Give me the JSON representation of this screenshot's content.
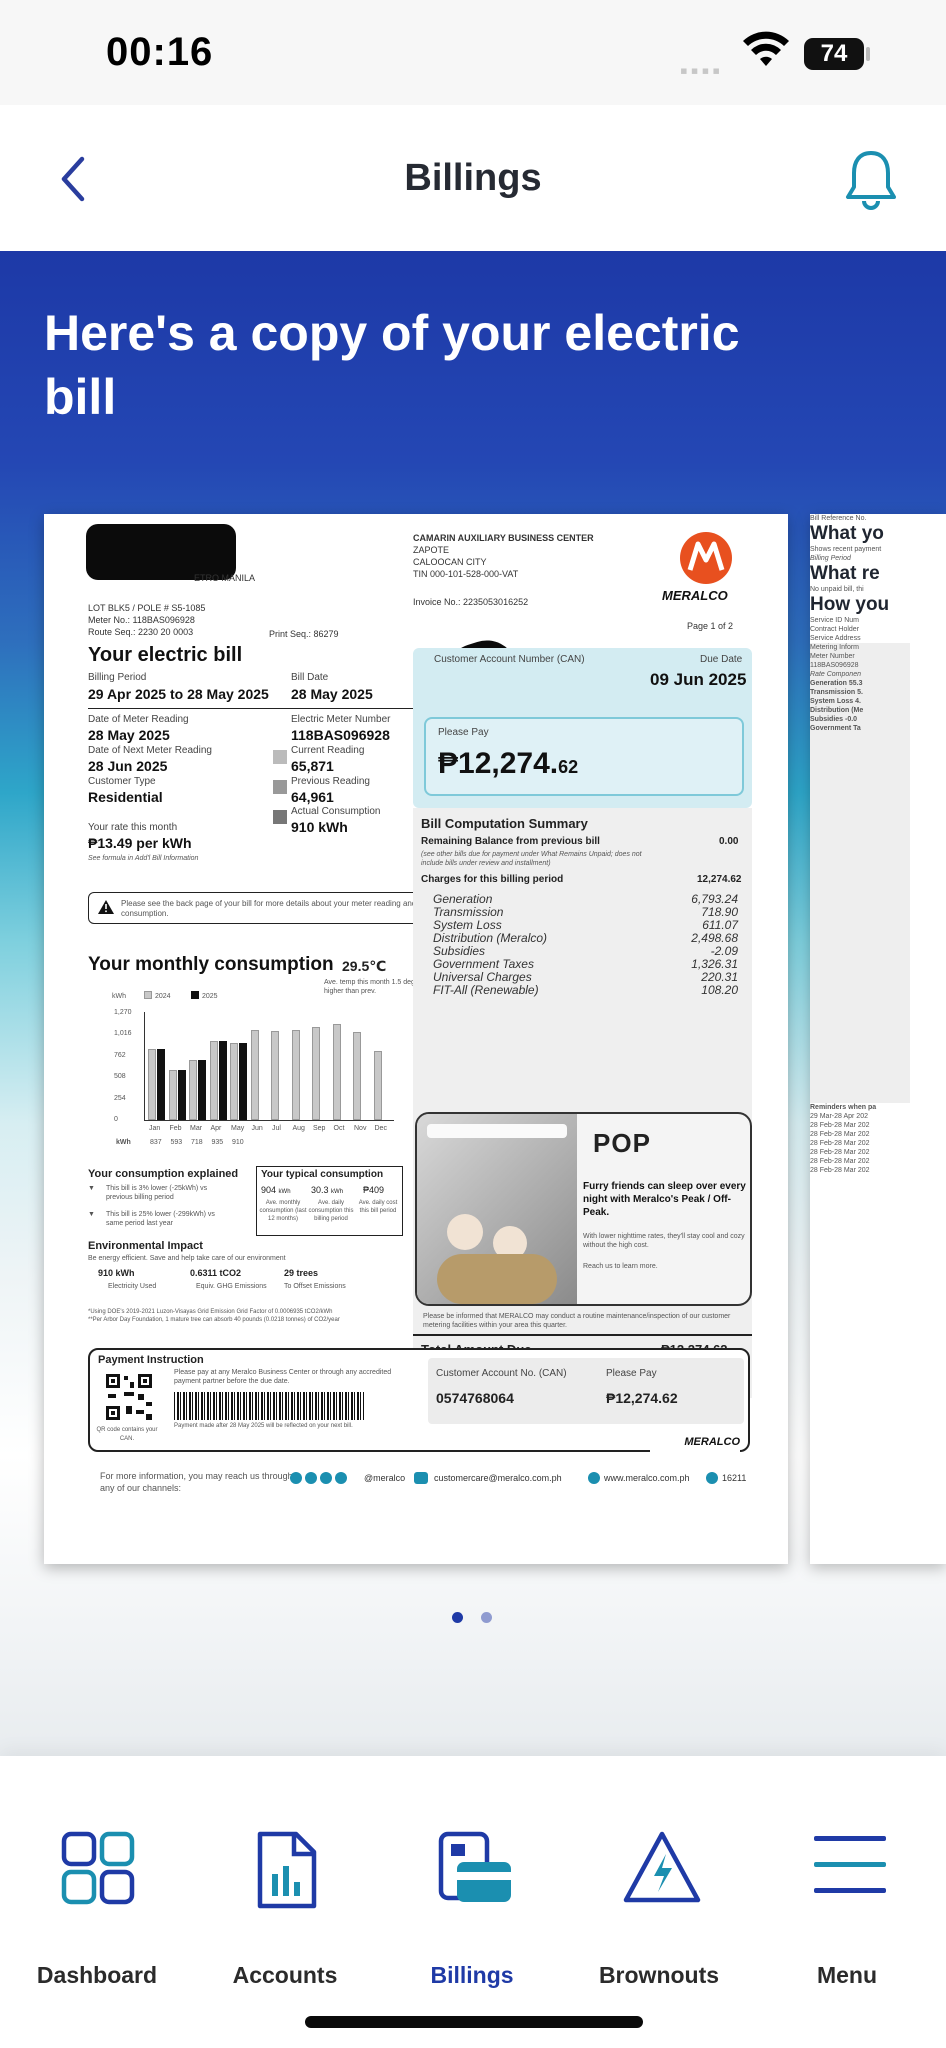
{
  "status_bar": {
    "time": "00:16",
    "battery": "74"
  },
  "header": {
    "title": "Billings"
  },
  "hero": {
    "headline": "Here's a copy of your electric bill"
  },
  "bill": {
    "address": {
      "line1": "LOT BLK5 / POLE # S5-1085",
      "meter_no": "Meter No.: 118BAS096928",
      "route_seq": "Route Seq.: 2230 20 0003",
      "print_seq": "Print Seq.: 86279",
      "partial": "ETRO MANILA"
    },
    "office": {
      "name": "CAMARIN AUXILIARY BUSINESS CENTER",
      "street": "ZAPOTE",
      "city": "CALOOCAN CITY",
      "tin": "TIN 000-101-528-000-VAT",
      "invoice": "Invoice No.: 2235053016252"
    },
    "brand": "MERALCO",
    "page": "Page 1 of 2",
    "your_bill_title": "Your electric bill",
    "billing_period_label": "Billing Period",
    "billing_period": "29 Apr 2025 to 28 May 2025",
    "bill_date_label": "Bill Date",
    "bill_date": "28 May 2025",
    "meter_reading_date_label": "Date of Meter Reading",
    "meter_reading_date": "28 May 2025",
    "next_reading_label": "Date of Next Meter Reading",
    "next_reading": "28 Jun 2025",
    "customer_type_label": "Customer Type",
    "customer_type": "Residential",
    "meter_number_label": "Electric Meter Number",
    "meter_number": "118BAS096928",
    "current_reading_label": "Current Reading",
    "current_reading": "65,871",
    "previous_reading_label": "Previous Reading",
    "previous_reading": "64,961",
    "actual_consumption_label": "Actual Consumption",
    "actual_consumption": "910 kWh",
    "rate_label": "Your rate this month",
    "rate": "₱13.49 per kWh",
    "rate_note": "See formula in Add'l Bill Information",
    "notice": "Please see the back page of your bill for more details about your meter reading and consumption.",
    "can_label": "Customer Account Number (CAN)",
    "due_date_label": "Due Date",
    "due_date": "09 Jun 2025",
    "please_pay_label": "Please Pay",
    "amount_main": "₱12,274.",
    "amount_cents": "62",
    "summary_title": "Bill Computation Summary",
    "remaining_label": "Remaining Balance from previous bill",
    "remaining_value": "0.00",
    "remaining_note": "(see other bills due for payment under What Remains Unpaid; does not include bills under review and installment)",
    "charges_label": "Charges for this billing period",
    "charges_value": "12,274.62",
    "charges": [
      {
        "name": "Generation",
        "value": "6,793.24"
      },
      {
        "name": "Transmission",
        "value": "718.90"
      },
      {
        "name": "System Loss",
        "value": "611.07"
      },
      {
        "name": "Distribution (Meralco)",
        "value": "2,498.68"
      },
      {
        "name": "Subsidies",
        "value": "-2.09"
      },
      {
        "name": "Government Taxes",
        "value": "1,326.31"
      },
      {
        "name": "Universal Charges",
        "value": "220.31"
      },
      {
        "name": "FIT-All (Renewable)",
        "value": "108.20"
      }
    ],
    "total_label": "Total Amount Due",
    "total_value": "₱12,274.62",
    "consumption_title": "Your monthly consumption",
    "temp": "29.5℃",
    "temp_note": "Ave. temp this month 1.5 deg higher than prev.",
    "kwh_label": "kWh",
    "legend_2024": "2024",
    "legend_2025": "2025",
    "y_ticks": [
      "1,270",
      "1,016",
      "762",
      "508",
      "254",
      "0"
    ],
    "months": [
      "Jan",
      "Feb",
      "Mar",
      "Apr",
      "May",
      "Jun",
      "Jul",
      "Aug",
      "Sep",
      "Oct",
      "Nov",
      "Dec"
    ],
    "kwh_row": [
      "837",
      "593",
      "718",
      "935",
      "910",
      "",
      "",
      "",
      "",
      "",
      "",
      ""
    ],
    "consumption_explained": "Your consumption explained",
    "explained_1": "This bill is 3% lower (-25kWh) vs previous billing period",
    "explained_2": "This bill is 25% lower (-299kWh) vs same period last year",
    "typical_title": "Your typical consumption",
    "typical": [
      {
        "value": "904",
        "unit": "kWh",
        "label": "Ave. monthly consumption (last 12 months)"
      },
      {
        "value": "30.3",
        "unit": "kWh",
        "label": "Ave. daily consumption this billing period"
      },
      {
        "value": "₱409",
        "unit": "",
        "label": "Ave. daily cost this bill period"
      }
    ],
    "env_title": "Environmental Impact",
    "env_sub": "Be energy efficient. Save and help take care of our environment",
    "env": [
      {
        "value": "910 kWh",
        "label": "Electricity Used"
      },
      {
        "value": "0.6311 tCO2",
        "label": "Equiv. GHG Emissions"
      },
      {
        "value": "29 trees",
        "label": "To Offset Emissions"
      }
    ],
    "env_note1": "*Using DOE's 2019-2021 Luzon-Visayas Grid Emission Grid Factor of 0.0006935 tCO2/kWh",
    "env_note2": "**Per Arbor Day Foundation, 1 mature tree can absorb 40 pounds (0.0218 tonnes) of CO2/year",
    "promo_brand": "POP",
    "promo_head": "Furry friends can sleep over every night with Meralco's Peak / Off-Peak.",
    "promo_body": "With lower nighttime rates, they'll stay cool and cozy without the high cost.",
    "promo_cta": "Reach us to learn more.",
    "maintenance_note": "Please be informed that MERALCO may conduct a routine maintenance/inspection of our customer metering facilities within your area this quarter.",
    "pay_instr_title": "Payment Instruction",
    "pay_instr_text": "Please pay at any Meralco Business Center or through any accredited payment partner before the due date.",
    "qr_caption": "QR code contains your CAN.",
    "barcode_note": "Payment made after 28 May 2025 will be reflected on your next bill.",
    "can_box_label": "Customer Account No. (CAN)",
    "can_box_value": "0574768064",
    "pay_box_label": "Please Pay",
    "pay_box_value": "₱12,274.62",
    "footer_text": "For more information, you may reach us through any of our channels:",
    "footer_social": "@meralco",
    "footer_email": "customercare@meralco.com.ph",
    "footer_web": "www.meralco.com.ph",
    "footer_hotline": "16211"
  },
  "bill2": {
    "ref": "Bill Reference No.",
    "what_you": "What yo",
    "shows": "Shows recent payment",
    "billing_period": "Billing Period",
    "rows": [
      "29 Mar-28 Apr 202",
      "28 Feb-28 Mar 202",
      "28 Feb-28 Mar 202",
      "28 Feb-28 Mar 202",
      "28 Feb-28 Mar 202",
      "28 Feb-28 Mar 202",
      "28 Feb-28 Mar 202"
    ],
    "what_re": "What re",
    "no_unpaid": "No unpaid bill, thi",
    "how_you": "How you",
    "svc": [
      "Service ID Num",
      "Contract Holder",
      "Service Address"
    ],
    "metering": "Metering Inform",
    "meter_number": "Meter Number",
    "meter_val": "118BAS096928",
    "rate_comp": "Rate Componen",
    "gen": "Generation 55.3",
    "trans": "Transmission 5.",
    "sysloss": "System Loss 4.",
    "dist": "Distribution (Me",
    "subsidies": "Subsidies -0.0",
    "govtax": "Government Ta",
    "reminders": "Reminders when pa"
  },
  "nav": [
    {
      "label": "Dashboard"
    },
    {
      "label": "Accounts"
    },
    {
      "label": "Billings"
    },
    {
      "label": "Brownouts"
    },
    {
      "label": "Menu"
    }
  ],
  "colors": {
    "primary": "#1f3aa6",
    "accent": "#1b8fb0",
    "meralco_orange": "#e8501f"
  }
}
